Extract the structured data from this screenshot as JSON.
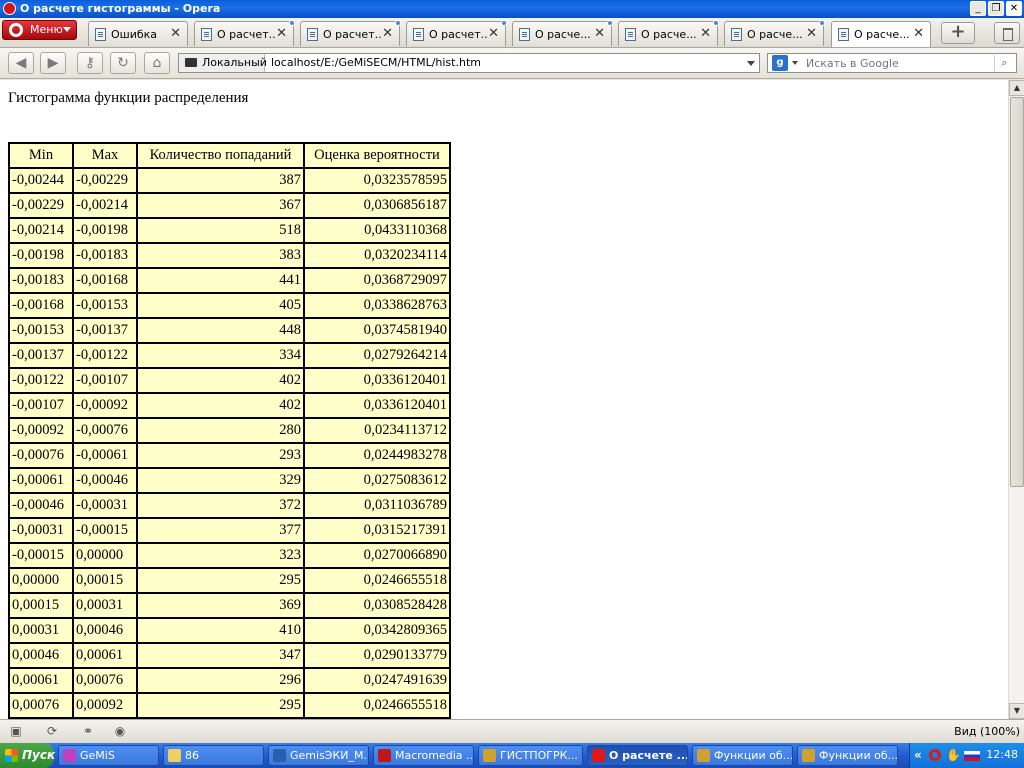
{
  "window": {
    "title": "О расчете гистограммы - Opera"
  },
  "menu_label": "Меню",
  "tabs": [
    {
      "label": "Ошибка",
      "active": false,
      "dot": false
    },
    {
      "label": "О расчет...",
      "active": false,
      "dot": true
    },
    {
      "label": "О расчет...",
      "active": false,
      "dot": true
    },
    {
      "label": "О расчет...",
      "active": false,
      "dot": true
    },
    {
      "label": "О расче...",
      "active": false,
      "dot": true
    },
    {
      "label": "О расче...",
      "active": false,
      "dot": true
    },
    {
      "label": "О расче...",
      "active": false,
      "dot": true
    },
    {
      "label": "О расче...",
      "active": true,
      "dot": false
    }
  ],
  "address": {
    "badge": "Локальный",
    "url": "localhost/E:/GeMiSECM/HTML/hist.htm"
  },
  "search": {
    "placeholder": "Искать в Google"
  },
  "page": {
    "heading": "Гистограмма функции распределения",
    "table": {
      "headers": [
        "Min",
        "Max",
        "Количество попаданий",
        "Оценка вероятности"
      ],
      "rows": [
        [
          "-0,00244",
          "-0,00229",
          "387",
          "0,0323578595"
        ],
        [
          "-0,00229",
          "-0,00214",
          "367",
          "0,0306856187"
        ],
        [
          "-0,00214",
          "-0,00198",
          "518",
          "0,0433110368"
        ],
        [
          "-0,00198",
          "-0,00183",
          "383",
          "0,0320234114"
        ],
        [
          "-0,00183",
          "-0,00168",
          "441",
          "0,0368729097"
        ],
        [
          "-0,00168",
          "-0,00153",
          "405",
          "0,0338628763"
        ],
        [
          "-0,00153",
          "-0,00137",
          "448",
          "0,0374581940"
        ],
        [
          "-0,00137",
          "-0,00122",
          "334",
          "0,0279264214"
        ],
        [
          "-0,00122",
          "-0,00107",
          "402",
          "0,0336120401"
        ],
        [
          "-0,00107",
          "-0,00092",
          "402",
          "0,0336120401"
        ],
        [
          "-0,00092",
          "-0,00076",
          "280",
          "0,0234113712"
        ],
        [
          "-0,00076",
          "-0,00061",
          "293",
          "0,0244983278"
        ],
        [
          "-0,00061",
          "-0,00046",
          "329",
          "0,0275083612"
        ],
        [
          "-0,00046",
          "-0,00031",
          "372",
          "0,0311036789"
        ],
        [
          "-0,00031",
          "-0,00015",
          "377",
          "0,0315217391"
        ],
        [
          "-0,00015",
          " 0,00000",
          "323",
          "0,0270066890"
        ],
        [
          " 0,00000",
          " 0,00015",
          "295",
          "0,0246655518"
        ],
        [
          " 0,00015",
          " 0,00031",
          "369",
          "0,0308528428"
        ],
        [
          " 0,00031",
          " 0,00046",
          "410",
          "0,0342809365"
        ],
        [
          " 0,00046",
          " 0,00061",
          "347",
          "0,0290133779"
        ],
        [
          " 0,00061",
          " 0,00076",
          "296",
          "0,0247491639"
        ],
        [
          " 0,00076",
          " 0,00092",
          "295",
          "0,0246655518"
        ]
      ]
    }
  },
  "statusbar": {
    "zoom": "Вид (100%)"
  },
  "taskbar": {
    "start": "Пуск",
    "tasks": [
      {
        "label": "GeMiS",
        "icon_color": "#c040c0",
        "active": false
      },
      {
        "label": "86",
        "icon_color": "#f0d060",
        "active": false
      },
      {
        "label": "GemisЭКИ_M...",
        "icon_color": "#2a5fb0",
        "active": false
      },
      {
        "label": "Macromedia ...",
        "icon_color": "#c01818",
        "active": false
      },
      {
        "label": "ГИСТПОГРК...",
        "icon_color": "#d0a030",
        "active": false
      },
      {
        "label": "О расчете ...",
        "icon_color": "#e01818",
        "active": true
      },
      {
        "label": "Функции об...",
        "icon_color": "#d0a030",
        "active": false
      },
      {
        "label": "Функции об...",
        "icon_color": "#d0a030",
        "active": false
      }
    ],
    "clock": "12:48"
  }
}
